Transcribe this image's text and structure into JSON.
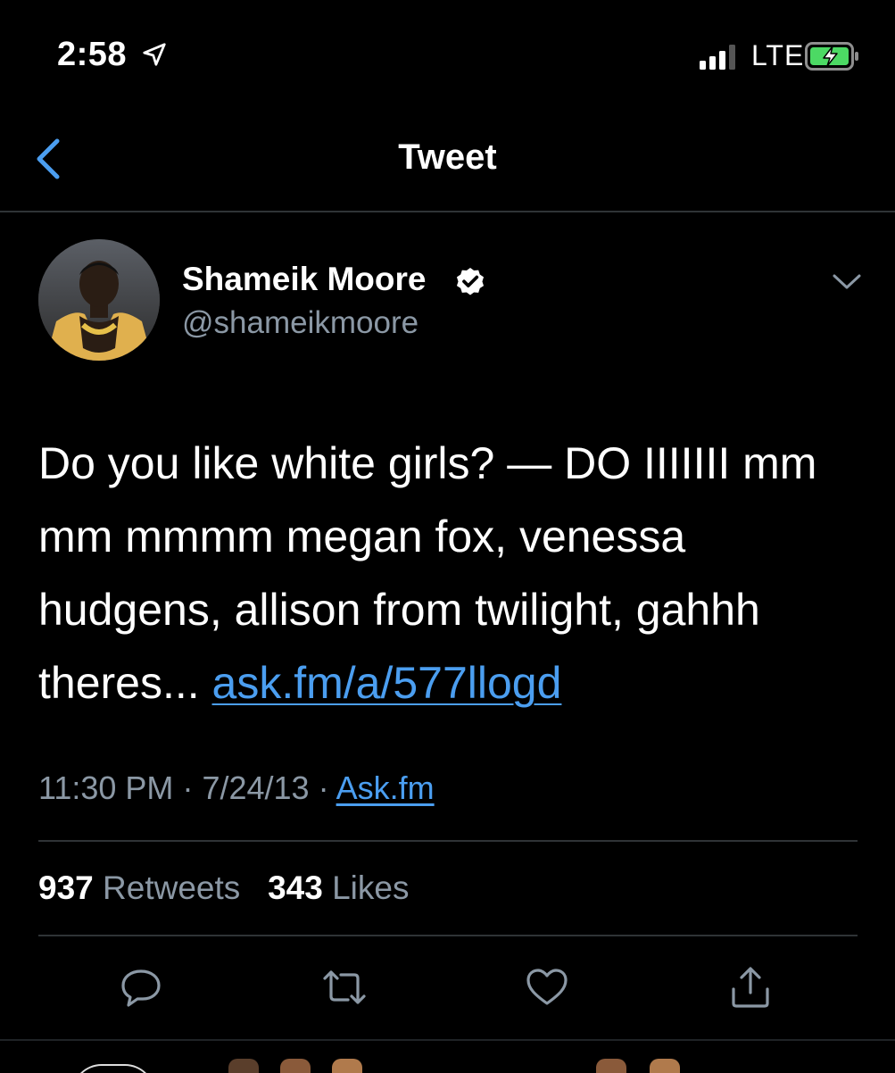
{
  "status_bar": {
    "time": "2:58",
    "location_icon": "location-arrow-icon",
    "signal_icon": "cellular-signal-icon",
    "network": "LTE",
    "battery_icon": "battery-charging-icon",
    "battery_color": "#4cd964"
  },
  "nav": {
    "back_icon": "chevron-left-icon",
    "title": "Tweet"
  },
  "tweet": {
    "author": {
      "display_name": "Shameik Moore",
      "handle": "@shameikmoore",
      "verified_icon": "verified-badge-icon"
    },
    "menu_icon": "chevron-down-icon",
    "text": "Do you like white girls? — DO IIIIIII mm mm mmmm megan fox, venessa hudgens, allison from twilight, gahhh theres... ",
    "link": "ask.fm/a/577llogd",
    "time": "11:30 PM",
    "separator": "·",
    "date": "7/24/13",
    "source": "Ask.fm",
    "stats": {
      "retweets_count": "937",
      "retweets_label": "Retweets",
      "likes_count": "343",
      "likes_label": "Likes"
    },
    "actions": [
      "reply-icon",
      "retweet-icon",
      "like-icon",
      "share-icon"
    ]
  },
  "colors": {
    "background": "#000000",
    "text": "#ffffff",
    "secondary": "#8b98a5",
    "link": "#4b9ef0",
    "divider": "#2f3336"
  }
}
